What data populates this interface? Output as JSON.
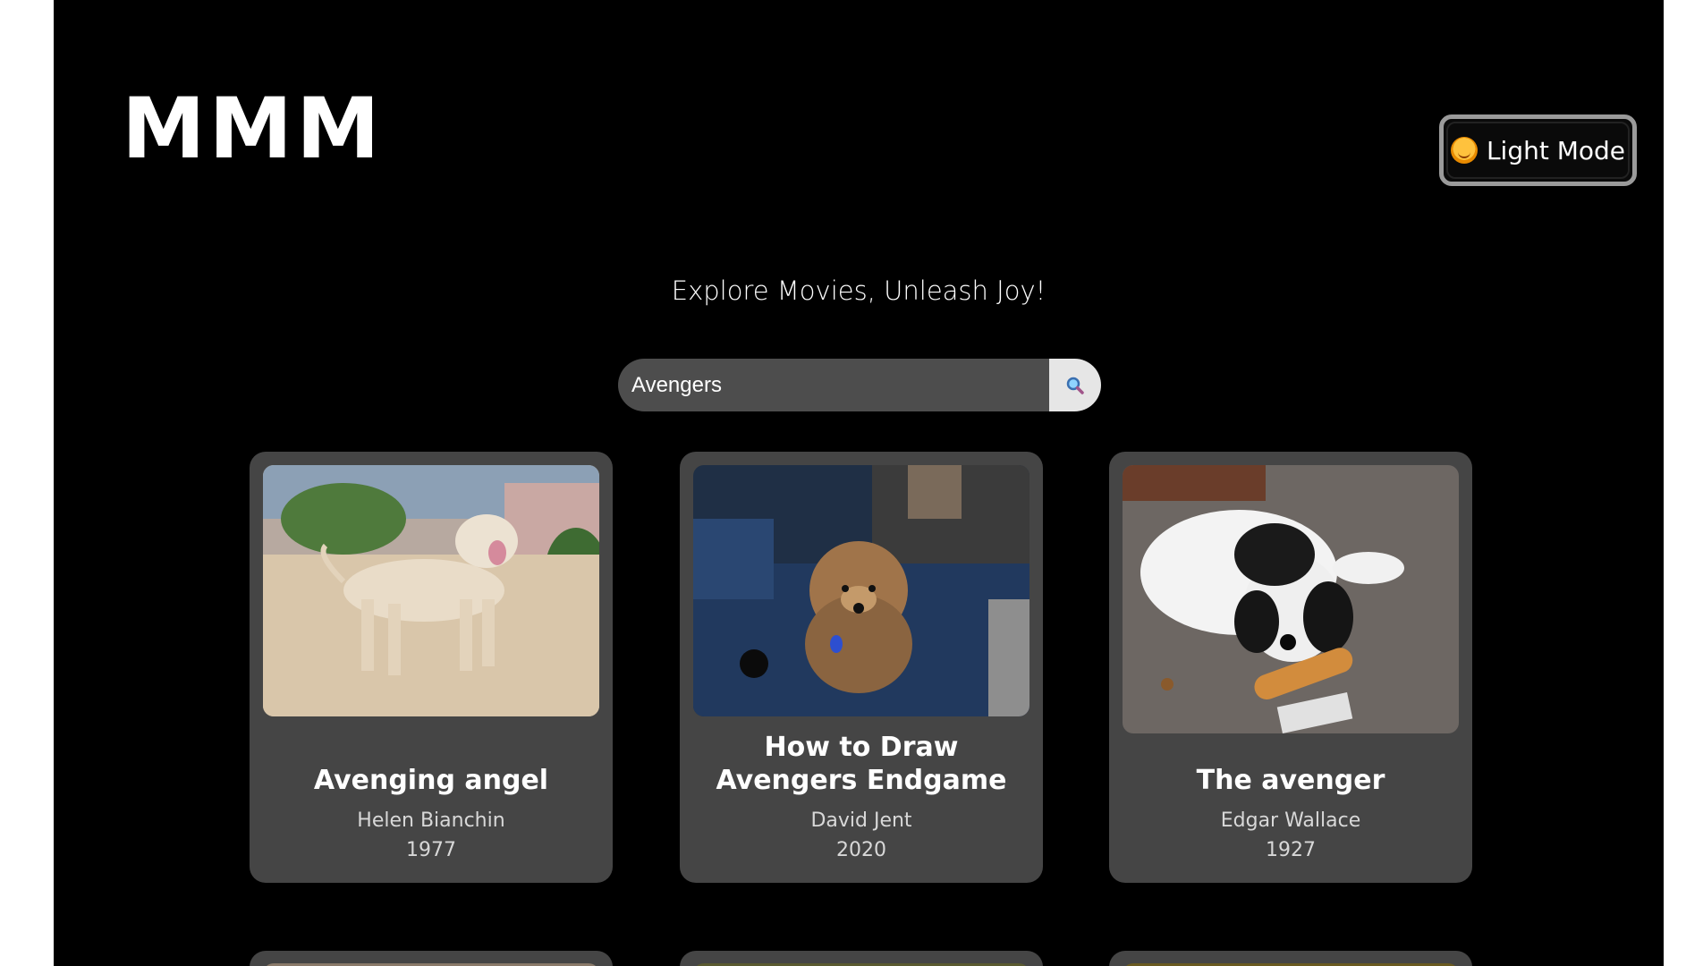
{
  "app": {
    "logo": "MMM",
    "theme_toggle": {
      "label": "Light Mode",
      "icon": "sun-icon"
    },
    "tagline": "Explore Movies, Unleash Joy!"
  },
  "search": {
    "value": "Avengers",
    "button_icon": "search-icon"
  },
  "results": [
    {
      "title": "Avenging angel",
      "author": "Helen Bianchin",
      "year": "1977",
      "image": "white dog standing on sandy ground"
    },
    {
      "title": "How to Draw Avengers Endgame",
      "author": "David Jent",
      "year": "2020",
      "image": "scruffy terrier sitting on blue sofa"
    },
    {
      "title": "The avenger",
      "author": "Edgar Wallace",
      "year": "1927",
      "image": "black and white puppy with dog bone"
    }
  ],
  "colors": {
    "page_bg": "#000000",
    "card_bg": "#454545",
    "search_bg": "#4d4d4d",
    "text": "#ffffff"
  }
}
